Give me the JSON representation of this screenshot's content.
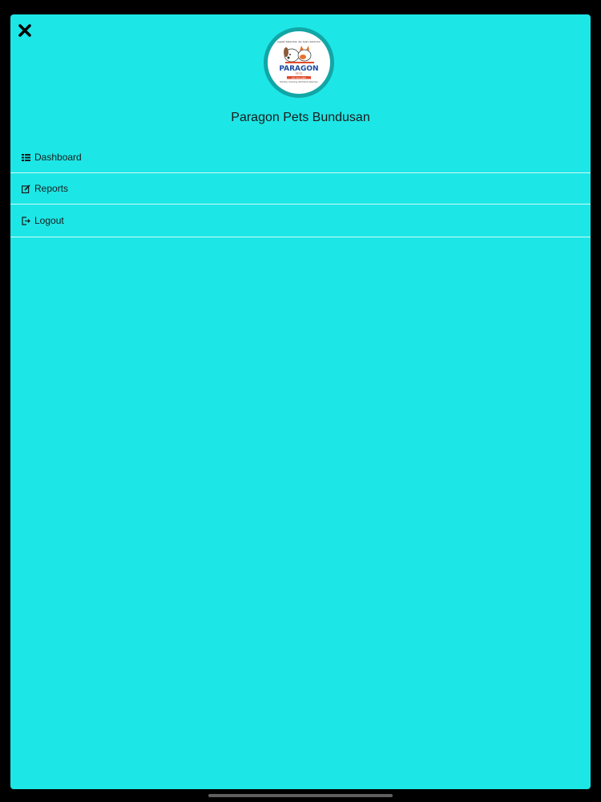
{
  "header": {
    "close_icon": "close-icon",
    "store_name": "Paragon Pets Bundusan"
  },
  "logo": {
    "top_text": "Jagalah Kebersihan dan Selalu Sehat Ikut",
    "brand": "PARAGON",
    "sub_brand": "PETS",
    "tagline": "we love pets",
    "footer_text": "Pet Shop, Grooming, Pet Hotel & Veterinary"
  },
  "menu": {
    "items": [
      {
        "label": "Dashboard",
        "icon": "list-icon"
      },
      {
        "label": "Reports",
        "icon": "edit-icon"
      },
      {
        "label": "Logout",
        "icon": "logout-icon"
      }
    ]
  },
  "colors": {
    "background": "#1de6e6",
    "logo_ring": "#12a6a6",
    "text": "#1b1b1b",
    "divider": "#ffffff"
  }
}
